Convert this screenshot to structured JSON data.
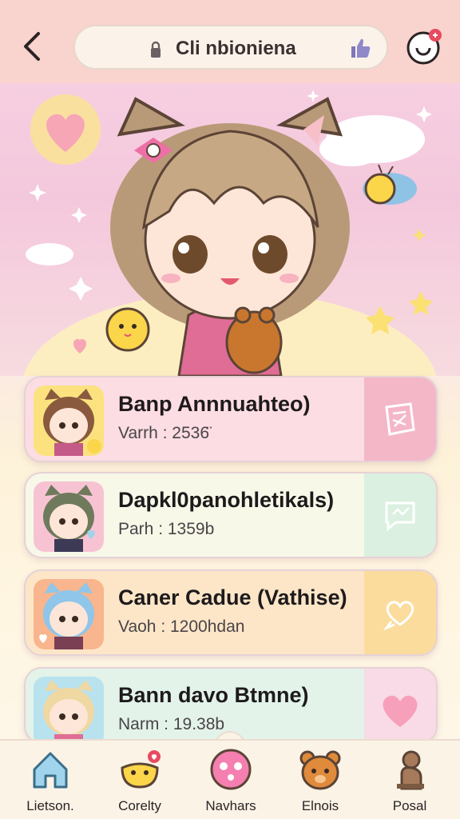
{
  "header": {
    "url_text": "Cli nbioniena",
    "back_icon": "chevron-left-icon",
    "lock_icon": "lock-icon",
    "thumb_icon": "thumb-up-icon",
    "profile_icon": "profile-icon"
  },
  "cards": [
    {
      "title": "Banp Annnuahteo)",
      "meta": "Varrh : 2536̈",
      "bg": "#fbdde3",
      "side_bg": "#f4b7c8",
      "icon": "book-icon"
    },
    {
      "title": "Dapkl0panohletikals)",
      "meta": "Parh : 1359b",
      "bg": "#f7f8e8",
      "side_bg": "#dbf0e0",
      "icon": "chat-icon"
    },
    {
      "title": "Caner Cadue (Vathise)",
      "meta": "Vaoh : 1200hdan",
      "bg": "#fde6c8",
      "side_bg": "#fbdc9c",
      "icon": "heart-bubble-icon"
    },
    {
      "title": "Bann davo Btmne)",
      "meta": "Narm : 19.38b",
      "bg": "#e3f3ea",
      "side_bg": "#f8dbe6",
      "icon": "heart-icon"
    }
  ],
  "nav": [
    {
      "label": "Lietson.",
      "icon": "home-icon"
    },
    {
      "label": "Corelty",
      "icon": "chick-icon"
    },
    {
      "label": "Navhars",
      "icon": "pink-face-icon"
    },
    {
      "label": "Elnois",
      "icon": "bear-icon"
    },
    {
      "label": "Posal",
      "icon": "puppet-icon"
    }
  ],
  "colors": {
    "topbar": "#f9d3cd",
    "accent": "#e84a5f"
  }
}
